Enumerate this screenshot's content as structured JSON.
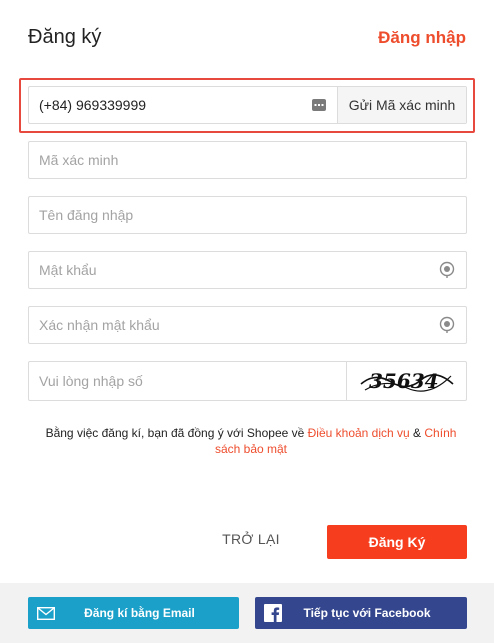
{
  "header": {
    "title": "Đăng ký",
    "login_link": "Đăng nhập"
  },
  "form": {
    "phone_value": "(+84) 969339999",
    "send_code_label": "Gửi Mã xác minh",
    "verification_placeholder": "Mã xác minh",
    "username_placeholder": "Tên đăng nhập",
    "password_placeholder": "Mật khẩu",
    "confirm_password_placeholder": "Xác nhận mật khẩu",
    "captcha_placeholder": "Vui lòng nhập số",
    "captcha_text": "35634"
  },
  "terms": {
    "prefix": "Bằng việc đăng kí, bạn đã đồng ý với Shopee về ",
    "terms_link": "Điều khoản dịch vụ",
    "joiner": " & ",
    "privacy_link": "Chính sách bảo mật"
  },
  "actions": {
    "back_label": "TRỞ LẠI",
    "register_label": "Đăng Ký"
  },
  "footer": {
    "email_label": "Đăng kí bằng Email",
    "facebook_label": "Tiếp tục với Facebook"
  },
  "colors": {
    "accent": "#ee4d2d",
    "register_button": "#f63e1e",
    "email_button": "#1ba0c9",
    "facebook_button": "#34468e",
    "highlight_border": "#e8493f"
  }
}
